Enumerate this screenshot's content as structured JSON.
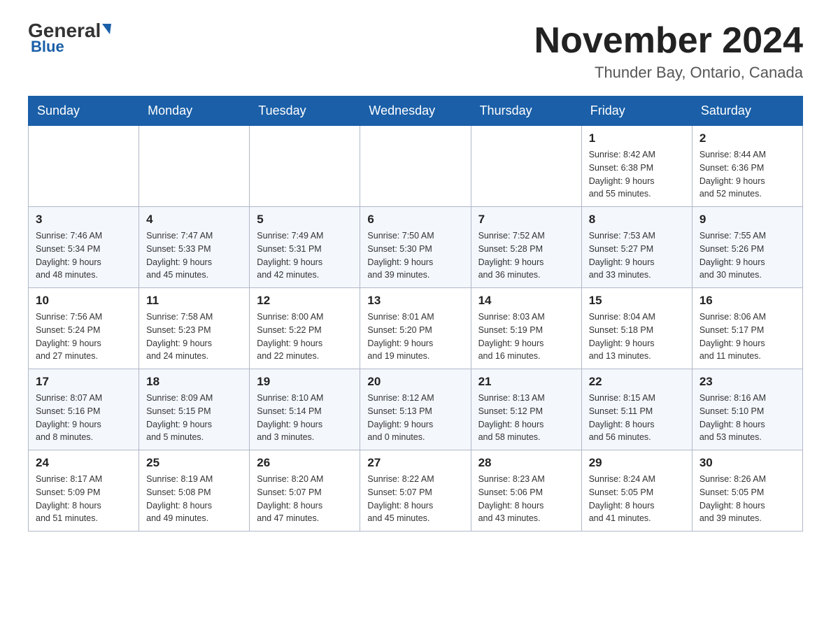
{
  "header": {
    "logo_general": "General",
    "logo_blue": "Blue",
    "month": "November 2024",
    "location": "Thunder Bay, Ontario, Canada"
  },
  "days_of_week": [
    "Sunday",
    "Monday",
    "Tuesday",
    "Wednesday",
    "Thursday",
    "Friday",
    "Saturday"
  ],
  "weeks": [
    [
      {
        "day": "",
        "info": ""
      },
      {
        "day": "",
        "info": ""
      },
      {
        "day": "",
        "info": ""
      },
      {
        "day": "",
        "info": ""
      },
      {
        "day": "",
        "info": ""
      },
      {
        "day": "1",
        "info": "Sunrise: 8:42 AM\nSunset: 6:38 PM\nDaylight: 9 hours\nand 55 minutes."
      },
      {
        "day": "2",
        "info": "Sunrise: 8:44 AM\nSunset: 6:36 PM\nDaylight: 9 hours\nand 52 minutes."
      }
    ],
    [
      {
        "day": "3",
        "info": "Sunrise: 7:46 AM\nSunset: 5:34 PM\nDaylight: 9 hours\nand 48 minutes."
      },
      {
        "day": "4",
        "info": "Sunrise: 7:47 AM\nSunset: 5:33 PM\nDaylight: 9 hours\nand 45 minutes."
      },
      {
        "day": "5",
        "info": "Sunrise: 7:49 AM\nSunset: 5:31 PM\nDaylight: 9 hours\nand 42 minutes."
      },
      {
        "day": "6",
        "info": "Sunrise: 7:50 AM\nSunset: 5:30 PM\nDaylight: 9 hours\nand 39 minutes."
      },
      {
        "day": "7",
        "info": "Sunrise: 7:52 AM\nSunset: 5:28 PM\nDaylight: 9 hours\nand 36 minutes."
      },
      {
        "day": "8",
        "info": "Sunrise: 7:53 AM\nSunset: 5:27 PM\nDaylight: 9 hours\nand 33 minutes."
      },
      {
        "day": "9",
        "info": "Sunrise: 7:55 AM\nSunset: 5:26 PM\nDaylight: 9 hours\nand 30 minutes."
      }
    ],
    [
      {
        "day": "10",
        "info": "Sunrise: 7:56 AM\nSunset: 5:24 PM\nDaylight: 9 hours\nand 27 minutes."
      },
      {
        "day": "11",
        "info": "Sunrise: 7:58 AM\nSunset: 5:23 PM\nDaylight: 9 hours\nand 24 minutes."
      },
      {
        "day": "12",
        "info": "Sunrise: 8:00 AM\nSunset: 5:22 PM\nDaylight: 9 hours\nand 22 minutes."
      },
      {
        "day": "13",
        "info": "Sunrise: 8:01 AM\nSunset: 5:20 PM\nDaylight: 9 hours\nand 19 minutes."
      },
      {
        "day": "14",
        "info": "Sunrise: 8:03 AM\nSunset: 5:19 PM\nDaylight: 9 hours\nand 16 minutes."
      },
      {
        "day": "15",
        "info": "Sunrise: 8:04 AM\nSunset: 5:18 PM\nDaylight: 9 hours\nand 13 minutes."
      },
      {
        "day": "16",
        "info": "Sunrise: 8:06 AM\nSunset: 5:17 PM\nDaylight: 9 hours\nand 11 minutes."
      }
    ],
    [
      {
        "day": "17",
        "info": "Sunrise: 8:07 AM\nSunset: 5:16 PM\nDaylight: 9 hours\nand 8 minutes."
      },
      {
        "day": "18",
        "info": "Sunrise: 8:09 AM\nSunset: 5:15 PM\nDaylight: 9 hours\nand 5 minutes."
      },
      {
        "day": "19",
        "info": "Sunrise: 8:10 AM\nSunset: 5:14 PM\nDaylight: 9 hours\nand 3 minutes."
      },
      {
        "day": "20",
        "info": "Sunrise: 8:12 AM\nSunset: 5:13 PM\nDaylight: 9 hours\nand 0 minutes."
      },
      {
        "day": "21",
        "info": "Sunrise: 8:13 AM\nSunset: 5:12 PM\nDaylight: 8 hours\nand 58 minutes."
      },
      {
        "day": "22",
        "info": "Sunrise: 8:15 AM\nSunset: 5:11 PM\nDaylight: 8 hours\nand 56 minutes."
      },
      {
        "day": "23",
        "info": "Sunrise: 8:16 AM\nSunset: 5:10 PM\nDaylight: 8 hours\nand 53 minutes."
      }
    ],
    [
      {
        "day": "24",
        "info": "Sunrise: 8:17 AM\nSunset: 5:09 PM\nDaylight: 8 hours\nand 51 minutes."
      },
      {
        "day": "25",
        "info": "Sunrise: 8:19 AM\nSunset: 5:08 PM\nDaylight: 8 hours\nand 49 minutes."
      },
      {
        "day": "26",
        "info": "Sunrise: 8:20 AM\nSunset: 5:07 PM\nDaylight: 8 hours\nand 47 minutes."
      },
      {
        "day": "27",
        "info": "Sunrise: 8:22 AM\nSunset: 5:07 PM\nDaylight: 8 hours\nand 45 minutes."
      },
      {
        "day": "28",
        "info": "Sunrise: 8:23 AM\nSunset: 5:06 PM\nDaylight: 8 hours\nand 43 minutes."
      },
      {
        "day": "29",
        "info": "Sunrise: 8:24 AM\nSunset: 5:05 PM\nDaylight: 8 hours\nand 41 minutes."
      },
      {
        "day": "30",
        "info": "Sunrise: 8:26 AM\nSunset: 5:05 PM\nDaylight: 8 hours\nand 39 minutes."
      }
    ]
  ]
}
